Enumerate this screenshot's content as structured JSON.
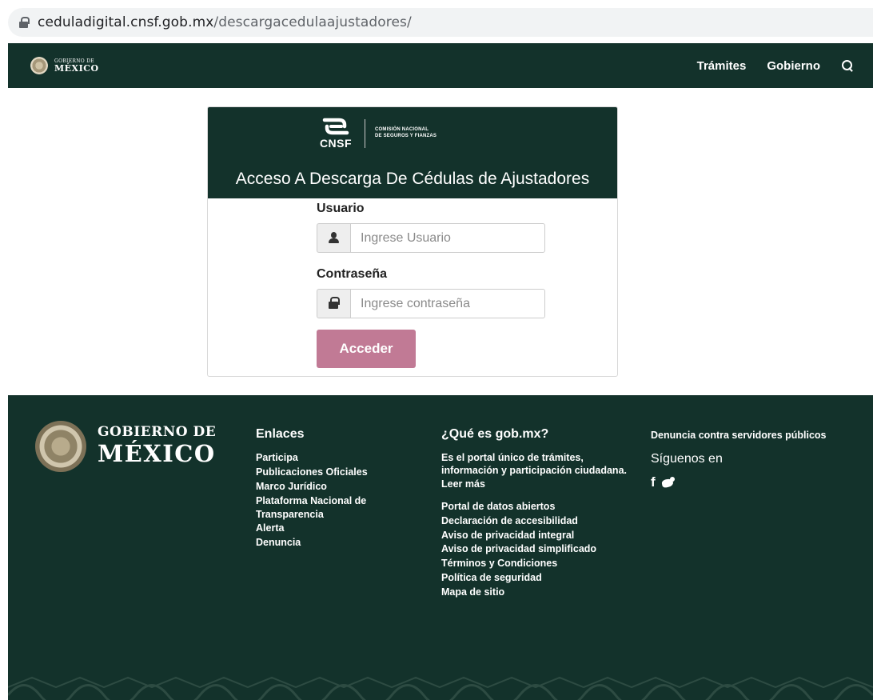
{
  "browser": {
    "url_domain": "ceduladigital.cnsf.gob.mx",
    "url_path": "/descargacedulaajustadores/"
  },
  "navbar": {
    "logo_small": "GOBIERNO DE",
    "logo_big": "MÉXICO",
    "links": [
      "Trámites",
      "Gobierno"
    ],
    "search_icon": "search-icon"
  },
  "card": {
    "brand_abbr": "CNSF",
    "brand_name_line1": "COMISIÓN NACIONAL",
    "brand_name_line2": "DE SEGUROS Y FIANZAS",
    "title": "Acceso A Descarga De Cédulas de Ajustadores",
    "user_label": "Usuario",
    "user_placeholder": "Ingrese Usuario",
    "user_value": "",
    "pass_label": "Contraseña",
    "pass_placeholder": "Ingrese contraseña",
    "pass_value": "",
    "submit": "Acceder",
    "colors": {
      "header": "#13322b",
      "button": "#c17a95"
    }
  },
  "footer": {
    "logo_small": "GOBIERNO DE",
    "logo_big": "MÉXICO",
    "links_title": "Enlaces",
    "links": [
      "Participa",
      "Publicaciones Oficiales",
      "Marco Jurídico",
      "Plataforma Nacional de Transparencia",
      "Alerta",
      "Denuncia"
    ],
    "about_title": "¿Qué es gob.mx?",
    "about_text": "Es el portal único de trámites, información y participación ciudadana. Leer más",
    "about_links": [
      "Portal de datos abiertos",
      "Declaración de accesibilidad",
      "Aviso de privacidad integral",
      "Aviso de privacidad simplificado",
      "Términos y Condiciones",
      "Política de seguridad",
      "Mapa de sitio"
    ],
    "denuncia": "Denuncia contra servidores públicos",
    "follow_title": "Síguenos en",
    "facebook_glyph": "f",
    "social_icons": [
      "facebook-icon",
      "twitter-icon"
    ],
    "color": "#13322b"
  }
}
